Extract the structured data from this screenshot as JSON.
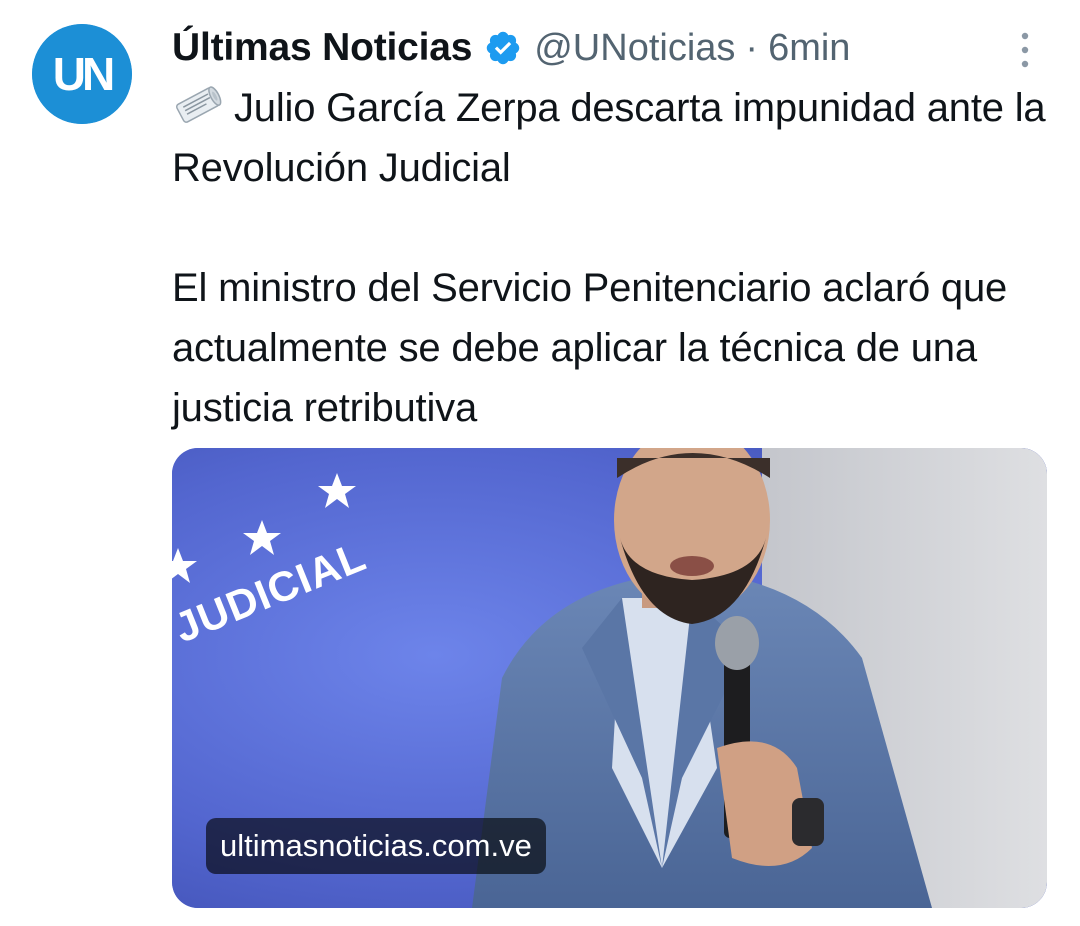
{
  "tweet": {
    "display_name": "Últimas Noticias",
    "handle": "@UNoticias",
    "separator": "·",
    "time": "6min",
    "avatar_text": "UN",
    "headline": "Julio García Zerpa descarta impunidad ante la Revolución Judicial",
    "body": "El ministro del Servicio Penitenciario aclaró que actualmente se debe aplicar la técnica de una justicia retributiva",
    "headline_icon": "newspaper-roll-icon",
    "media": {
      "background_text": "JUDICIAL",
      "link_domain": "ultimasnoticias.com.ve"
    }
  },
  "icons": {
    "verified": "verified-badge-icon",
    "more": "more-options-icon"
  },
  "colors": {
    "avatar_bg": "#1c8fd6",
    "verified_blue": "#1d9bf0",
    "secondary_text": "#536471",
    "primary_text": "#0f1419",
    "media_backdrop": "#5c72d6"
  }
}
